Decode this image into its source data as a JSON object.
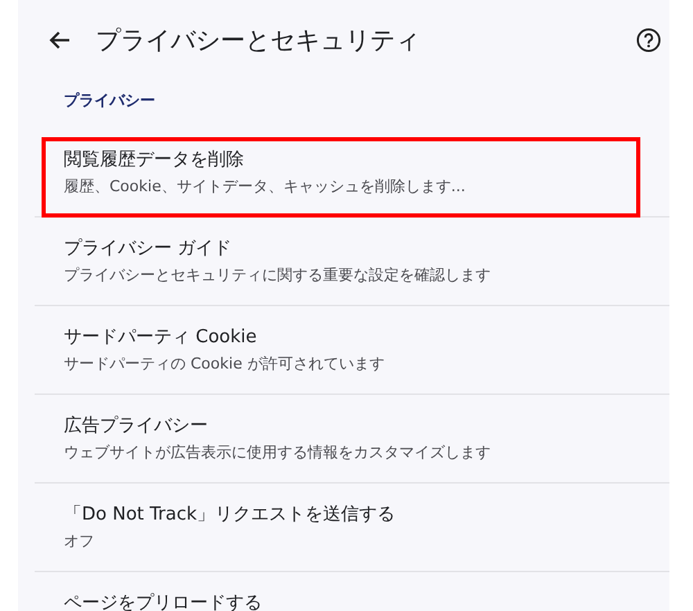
{
  "header": {
    "title": "プライバシーとセキュリティ"
  },
  "section": {
    "label": "プライバシー"
  },
  "items": [
    {
      "title": "閲覧履歴データを削除",
      "subtitle": "履歴、Cookie、サイトデータ、キャッシュを削除します...",
      "highlighted": true
    },
    {
      "title": "プライバシー ガイド",
      "subtitle": "プライバシーとセキュリティに関する重要な設定を確認します",
      "highlighted": false
    },
    {
      "title": "サードパーティ Cookie",
      "subtitle": "サードパーティの Cookie が許可されています",
      "highlighted": false
    },
    {
      "title": "広告プライバシー",
      "subtitle": "ウェブサイトが広告表示に使用する情報をカスタマイズします",
      "highlighted": false
    },
    {
      "title": "「Do Not Track」リクエストを送信する",
      "subtitle": "オフ",
      "highlighted": false
    },
    {
      "title": "ページをプリロードする",
      "highlighted": false
    }
  ]
}
